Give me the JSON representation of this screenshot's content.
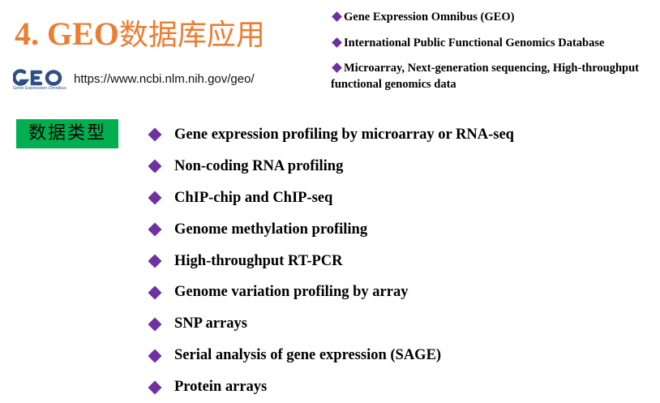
{
  "header": {
    "title_prefix": "4. GEO",
    "title_cjk": "数据库应用"
  },
  "logo": {
    "text": "GEO",
    "subtext": "Gene Expression Omnibus",
    "icon": "geo-logo-icon",
    "color": "#2e4e86"
  },
  "url": "https://www.ncbi.nlm.nih.gov/geo/",
  "facts": [
    "Gene Expression Omnibus (GEO)",
    "International Public Functional Genomics Database",
    "Microarray, Next-generation sequencing, High-throughput functional genomics data"
  ],
  "data_types": {
    "label": "数据类型",
    "items": [
      "Gene expression profiling by microarray  or RNA-seq",
      "Non-coding RNA profiling",
      "ChIP-chip and ChIP-seq",
      "Genome methylation profiling",
      "High-throughput RT-PCR",
      "Genome variation profiling by array",
      "SNP arrays",
      "Serial analysis of gene expression  (SAGE)",
      "Protein arrays"
    ]
  },
  "colors": {
    "title": "#ed7d31",
    "bullet": "#7030a0",
    "badge": "#00b050",
    "logo": "#2e4e86"
  }
}
